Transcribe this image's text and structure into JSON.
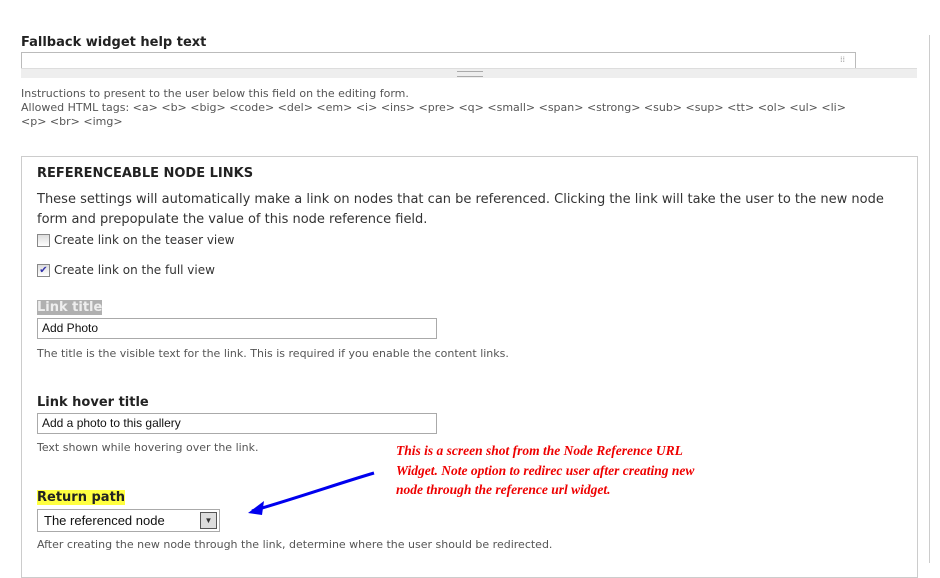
{
  "fallback": {
    "label": "Fallback widget help text",
    "value": "",
    "desc1": "Instructions to present to the user below this field on the editing form.",
    "desc2": "Allowed HTML tags: <a> <b> <big> <code> <del> <em> <i> <ins> <pre> <q> <small> <span> <strong> <sub> <sup> <tt> <ol> <ul> <li>",
    "desc3": "<p> <br> <img>"
  },
  "fieldset": {
    "legend": "REFERENCEABLE NODE LINKS",
    "intro": "These settings will automatically make a link on nodes that can be referenced. Clicking the link will take the user to the new node form and prepopulate the value of this node reference field.",
    "checkboxes": [
      {
        "label": "Create link on the teaser view",
        "checked": false
      },
      {
        "label": "Create link on the full view",
        "checked": true
      }
    ],
    "link_title": {
      "label": "Link title",
      "value": "Add Photo",
      "desc": "The title is the visible text for the link. This is required if you enable the content links."
    },
    "hover_title": {
      "label": "Link hover title",
      "value": "Add a photo to this gallery",
      "desc": "Text shown while hovering over the link."
    },
    "return_path": {
      "label": "Return path",
      "value": "The referenced node",
      "desc": "After creating the new node through the link, determine where the user should be redirected."
    }
  },
  "annotation": {
    "text": "This is a screen shot from the Node Reference URL Widget.  Note option to redirec user after creating new node through the reference url widget.",
    "color": "#ee0000",
    "arrow_color": "#0000ee"
  }
}
